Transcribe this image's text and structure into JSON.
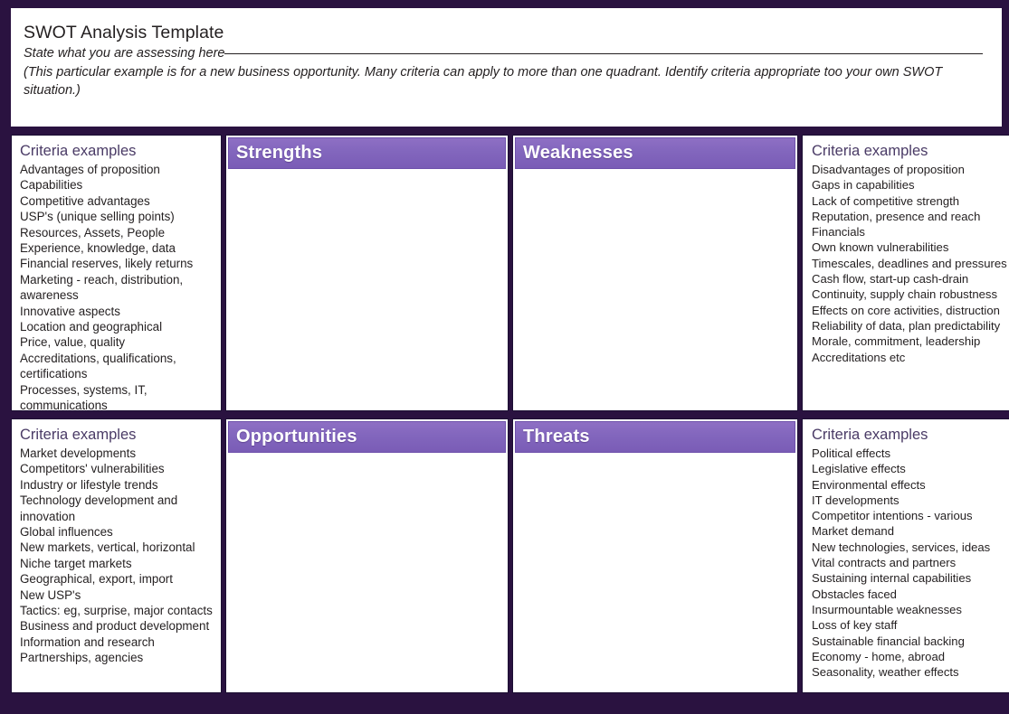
{
  "header": {
    "title": "SWOT Analysis Template",
    "subtitle": "State what you are assessing here",
    "note": "(This particular example is for a new business opportunity. Many criteria can apply to more than one quadrant. Identify criteria appropriate too your own SWOT situation.)"
  },
  "colors": {
    "frame": "#2a1240",
    "panel_border": "#1c0f33",
    "header_bar_top": "#8e6fc4",
    "header_bar_bottom": "#7a5cb6",
    "criteria_title": "#4a3b66",
    "body_text": "#231f20",
    "panel_bg": "#ffffff"
  },
  "criteria_title": "Criteria examples",
  "quadrants": {
    "strengths": {
      "label": "Strengths",
      "content": ""
    },
    "weaknesses": {
      "label": "Weaknesses",
      "content": ""
    },
    "opportunities": {
      "label": "Opportunities",
      "content": ""
    },
    "threats": {
      "label": "Threats",
      "content": ""
    }
  },
  "criteria": {
    "strengths": {
      "title": "Criteria examples",
      "items": [
        "Advantages of proposition",
        "Capabilities",
        "Competitive advantages",
        "USP's (unique selling points)",
        "Resources, Assets, People",
        "Experience, knowledge, data",
        "Financial reserves, likely returns",
        "Marketing -  reach, distribution, awareness",
        "Innovative aspects",
        "Location and geographical",
        "Price, value, quality",
        "Accreditations, qualifications, certifications",
        "Processes, systems, IT, communications"
      ]
    },
    "weaknesses": {
      "title": "Criteria examples",
      "items": [
        "Disadvantages of proposition",
        "Gaps in capabilities",
        "Lack of competitive strength",
        "Reputation, presence and reach",
        "Financials",
        "Own known vulnerabilities",
        "Timescales, deadlines and pressures",
        "Cash flow, start-up cash-drain",
        "Continuity, supply chain robustness",
        "Effects on core activities, distruction",
        "Reliability of data, plan predictability",
        "Morale, commitment, leadership",
        "Accreditations etc"
      ]
    },
    "opportunities": {
      "title": "Criteria examples",
      "items": [
        "Market developments",
        "Competitors' vulnerabilities",
        "Industry or lifestyle trends",
        "Technology development and innovation",
        "Global influences",
        "New markets, vertical, horizontal",
        "Niche target markets",
        "Geographical, export, import",
        "New USP's",
        "Tactics: eg, surprise, major contacts",
        "Business and product development",
        "Information and research",
        "Partnerships, agencies"
      ]
    },
    "threats": {
      "title": "Criteria examples",
      "items": [
        "Political effects",
        "Legislative effects",
        "Environmental effects",
        "IT developments",
        "Competitor intentions - various",
        "Market demand",
        "New technologies, services, ideas",
        "Vital contracts and partners",
        "Sustaining internal capabilities",
        "Obstacles faced",
        "Insurmountable weaknesses",
        "Loss of key staff",
        "Sustainable financial backing",
        "Economy - home, abroad",
        "Seasonality, weather effects"
      ]
    }
  }
}
